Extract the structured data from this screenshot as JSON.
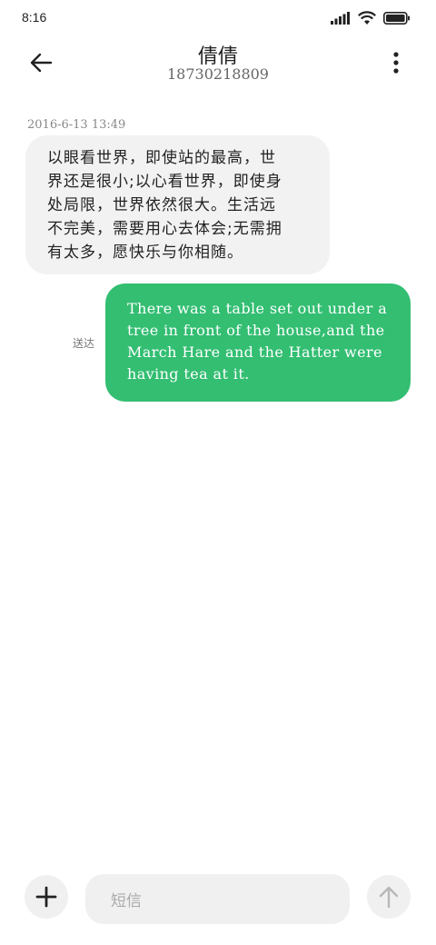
{
  "status_bar": {
    "time": "8:16",
    "icons": [
      "signal-icon",
      "wifi-icon",
      "battery-icon"
    ]
  },
  "header": {
    "contact_name": "倩倩",
    "contact_number": "18730218809",
    "back_icon": "back-arrow-icon",
    "menu_icon": "more-vertical-icon"
  },
  "messages": [
    {
      "direction": "incoming",
      "timestamp": "2016-6-13 13:49",
      "lines": [
        "以眼看世界，即使站的最高，世",
        "界还是很小;以心看世界，即使身",
        "处局限，世界依然很大。生活远",
        "不完美，需要用心去体会;无需拥",
        "有太多，愿快乐与你相随。"
      ]
    },
    {
      "direction": "outgoing",
      "status": "送达",
      "lines": [
        "There was a table set out under a",
        "tree in front of the house,and the",
        "March Hare and the Hatter were",
        "having tea at it."
      ]
    }
  ],
  "composer": {
    "placeholder": "短信",
    "add_icon": "plus-icon",
    "send_icon": "arrow-up-icon"
  },
  "colors": {
    "outgoing_bubble": "#33be72",
    "incoming_bubble": "#f2f2f2",
    "input_bg": "#f0f0f0"
  }
}
